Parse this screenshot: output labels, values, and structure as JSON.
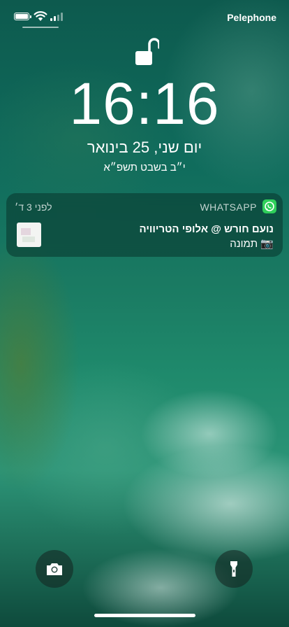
{
  "status_bar": {
    "carrier": "Pelephone",
    "battery_icon": "battery-full-icon",
    "wifi_icon": "wifi-icon",
    "signal_icon": "cellular-signal-icon",
    "signal_bars": 2
  },
  "lock": {
    "icon": "unlocked-padlock-icon"
  },
  "clock": {
    "time": "16:16"
  },
  "date": {
    "gregorian": "יום שני, 25 בינואר",
    "hebrew": "י״ב בשבט תשפ״א"
  },
  "notification": {
    "app_name": "WHATSAPP",
    "app_icon": "whatsapp-icon",
    "app_color": "#2fcf5a",
    "time": "לפני 3 ד׳",
    "title": "נועם חורש @ אלופי הטריוויה",
    "body": "📷 תמונה",
    "thumbnail": "image-thumbnail"
  },
  "quick_actions": {
    "camera_icon": "camera-icon",
    "flashlight_icon": "flashlight-icon"
  }
}
